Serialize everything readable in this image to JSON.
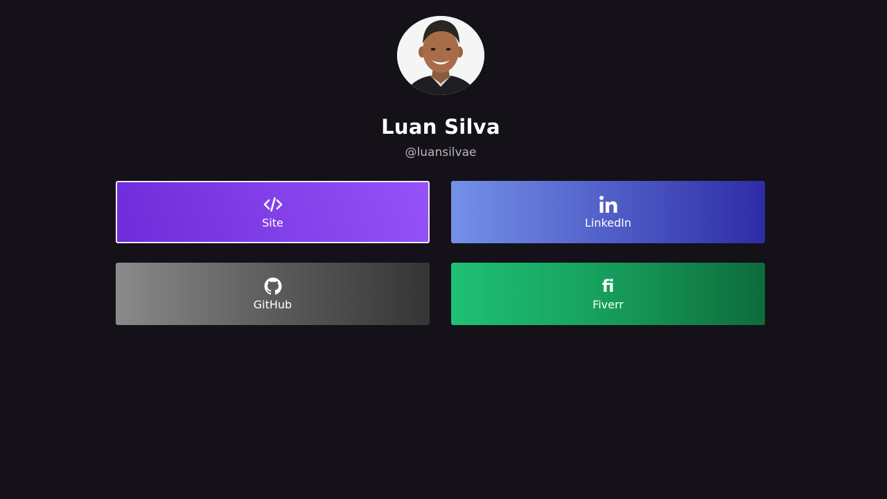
{
  "profile": {
    "name": "Luan Silva",
    "handle": "@luansilvae"
  },
  "links": [
    {
      "label": "Site",
      "icon": "code-icon",
      "colors": [
        "#6e2cd9",
        "#9453f7"
      ]
    },
    {
      "label": "LinkedIn",
      "icon": "linkedin-icon",
      "colors": [
        "#7591e8",
        "#2e2ca5"
      ]
    },
    {
      "label": "GitHub",
      "icon": "github-icon",
      "colors": [
        "#8a8a8a",
        "#353535"
      ]
    },
    {
      "label": "Fiverr",
      "icon": "fiverr-icon",
      "glyph": "fi",
      "colors": [
        "#1fc076",
        "#0e6b3b"
      ]
    }
  ],
  "theme": {
    "background": "#141118",
    "text": "#ffffff",
    "muted": "#b9b6bd"
  }
}
